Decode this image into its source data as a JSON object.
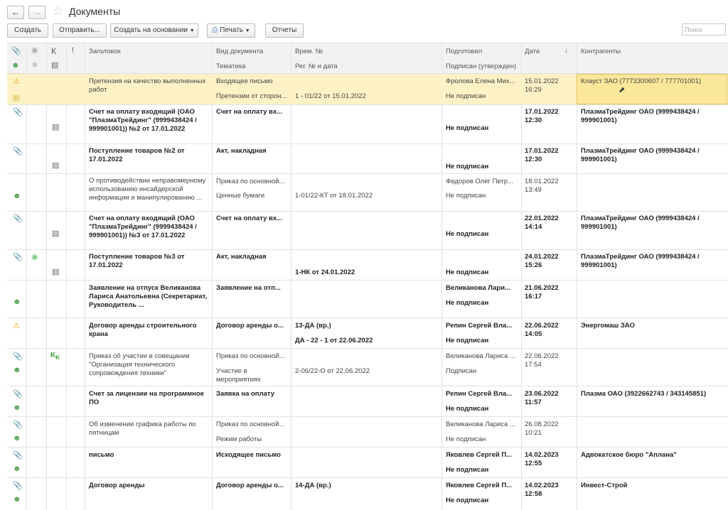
{
  "window": {
    "title": "Документы"
  },
  "toolbar": {
    "create": "Создать",
    "send": "Отправить...",
    "create_based": "Создать на основании",
    "print": "Печать",
    "reports": "Отчеты",
    "search_placeholder": "Поиск (Ctrl+F)"
  },
  "columns": {
    "k": "К",
    "excl": "!",
    "title": "Заголовок",
    "doc_type": "Вид документа",
    "topic": "Тематика",
    "time_no": "Врем. №",
    "reg_no": "Рег. № и дата",
    "prepared": "Подготовил",
    "signed": "Подписан (утвержден)",
    "date": "Дата",
    "contractors": "Контрагенты"
  },
  "rows": [
    {
      "title": "Претензия на качество выполненных работ",
      "doc_type": "Входящее письмо",
      "topic": "Претензии от сторон...",
      "time_no": "",
      "reg": "1 - 01/22 от 15.01.2022",
      "prepared": "Фролова Елена Мих...",
      "signed": "Не подписан",
      "date": "15.01.2022",
      "time": "16:29",
      "contractor": "Клауст ЗАО (7773300607 / 777701001)"
    },
    {
      "title": "Счет на оплату входящий (ОАО \"ПлазмаТрейдинг\" (9999438424 / 999901001)) №2 от 17.01.2022",
      "doc_type": "Счет на оплату вх...",
      "topic": "",
      "time_no": "",
      "reg": "",
      "prepared": "",
      "signed": "Не подписан",
      "date": "17.01.2022",
      "time": "12:30",
      "contractor": "ПлазмаТрейдинг ОАО (9999438424 / 999901001)"
    },
    {
      "title": "Поступление товаров №2 от 17.01.2022",
      "doc_type": "Акт, накладная",
      "topic": "",
      "time_no": "",
      "reg": "",
      "prepared": "",
      "signed": "Не подписан",
      "date": "17.01.2022",
      "time": "12:30",
      "contractor": "ПлазмаТрейдинг ОАО (9999438424 / 999901001)"
    },
    {
      "title": "О противодействии неправомерному использованию инсайдерской информации и манипулированию ...",
      "doc_type": "Приказ по основной...",
      "topic": "Ценные бумаги",
      "time_no": "",
      "reg": "1-01/22-КТ от 18.01.2022",
      "prepared": "Федоров Олег Петр...",
      "signed": "Не подписан",
      "date": "18.01.2022",
      "time": "13:49",
      "contractor": ""
    },
    {
      "title": "Счет на оплату входящий (ОАО \"ПлазмаТрейдинг\" (9999438424 / 999901001)) №3 от 17.01.2022",
      "doc_type": "Счет на оплату вх...",
      "topic": "",
      "time_no": "",
      "reg": "",
      "prepared": "",
      "signed": "Не подписан",
      "date": "22.01.2022",
      "time": "14:14",
      "contractor": "ПлазмаТрейдинг ОАО (9999438424 / 999901001)"
    },
    {
      "title": "Поступление товаров №3 от 17.01.2022",
      "doc_type": "Акт, накладная",
      "topic": "",
      "time_no": "",
      "reg": "1-НК от 24.01.2022",
      "prepared": "",
      "signed": "Не подписан",
      "date": "24.01.2022",
      "time": "15:26",
      "contractor": "ПлазмаТрейдинг ОАО (9999438424 / 999901001)"
    },
    {
      "title": "Заявление на отпуск Великанова Лариса Анатольевна (Секретариат, Руководитель ...",
      "doc_type": "Заявление на отп...",
      "topic": "",
      "time_no": "",
      "reg": "",
      "prepared": "Великанова Лари...",
      "signed": "Не подписан",
      "date": "21.06.2022",
      "time": "16:17",
      "contractor": ""
    },
    {
      "title": "Договор аренды строительного крана",
      "doc_type": "Договор аренды о...",
      "topic": "",
      "time_no": "13-ДА (вр.)",
      "reg": "ДА - 22 - 1 от 22.06.2022",
      "prepared": "Репин Сергей Вла...",
      "signed": "Не подписан",
      "date": "22.06.2022",
      "time": "14:05",
      "contractor": "Энергомаш ЗАО"
    },
    {
      "title": "Приказ об участии в совещании \"Организация технического сопровождения техники\"",
      "doc_type": "Приказ по основной...",
      "topic": "Участие в мероприятиях",
      "time_no": "",
      "reg": "2-06/22-О от 22.06.2022",
      "prepared": "Великанова Лариса ...",
      "signed": "Подписан",
      "date": "22.06.2022",
      "time": "17:54",
      "contractor": ""
    },
    {
      "title": "Счет за лицензии на программное ПО",
      "doc_type": "Заявка на оплату",
      "topic": "",
      "time_no": "",
      "reg": "",
      "prepared": "Репин Сергей Вла...",
      "signed": "Не подписан",
      "date": "23.06.2022",
      "time": "11:57",
      "contractor": "Плазма ОАО (3922662743 / 343145851)"
    },
    {
      "title": "Об изменении графика работы по пятницам",
      "doc_type": "Приказ по основной...",
      "topic": "Режим работы",
      "time_no": "",
      "reg": "",
      "prepared": "Великанова Лариса ...",
      "signed": "Не подписан",
      "date": "26.08.2022",
      "time": "10:21",
      "contractor": ""
    },
    {
      "title": "письмо",
      "doc_type": "Исходящее письмо",
      "topic": "",
      "time_no": "",
      "reg": "",
      "prepared": "Яковлев Сергей П...",
      "signed": "Не подписан",
      "date": "14.02.2023",
      "time": "12:55",
      "contractor": "Адвокатское бюро \"Аплана\""
    },
    {
      "title": "Договор аренды",
      "doc_type": "Договор аренды о...",
      "topic": "",
      "time_no": "14-ДА (вр.)",
      "reg": "",
      "prepared": "Яковлев Сергей П...",
      "signed": "Не подписан",
      "date": "14.02.2023",
      "time": "12:58",
      "contractor": "Инвест-Строй"
    }
  ]
}
